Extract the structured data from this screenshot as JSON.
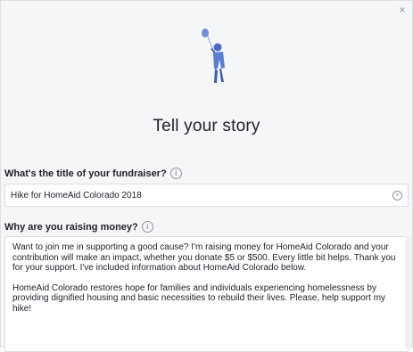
{
  "dialog": {
    "close_glyph": "×",
    "hero_icon": "person-with-balloon-icon",
    "title": "Tell your story"
  },
  "title_field": {
    "label": "What's the title of your fundraiser?",
    "info_glyph": "i",
    "value": "Hike for HomeAid Colorado 2018",
    "clear_glyph": "×"
  },
  "reason_field": {
    "label": "Why are you raising money?",
    "info_glyph": "i",
    "paragraph_1": "Want to join me in supporting a good cause? I'm raising money for HomeAid Colorado and your contribution will make an impact, whether you donate $5 or $500. Every little bit helps. Thank you for your support. I've included information about HomeAid Colorado below.",
    "paragraph_2": "HomeAid Colorado restores hope for families and individuals experiencing homelessness by providing dignified housing and basic necessities to rebuild their lives. Please, help support my hike!"
  }
}
